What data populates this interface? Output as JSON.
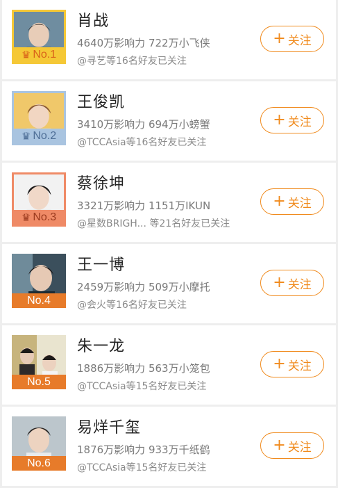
{
  "ranking": [
    {
      "rank": "No.1",
      "name": "肖战",
      "stats": "4640万影响力 722万小飞侠",
      "friends": "@寻艺等16名好友已关注",
      "follow": "关注",
      "badge": "crown"
    },
    {
      "rank": "No.2",
      "name": "王俊凯",
      "stats": "3410万影响力 694万小螃蟹",
      "friends": "@TCCAsia等16名好友已关注",
      "follow": "关注",
      "badge": "crown"
    },
    {
      "rank": "No.3",
      "name": "蔡徐坤",
      "stats": "3321万影响力 1151万IKUN",
      "friends": "@星数BRIGH...  等21名好友已关注",
      "follow": "关注",
      "badge": "crown"
    },
    {
      "rank": "No.4",
      "name": "王一博",
      "stats": "2459万影响力 509万小摩托",
      "friends": "@会火等16名好友已关注",
      "follow": "关注"
    },
    {
      "rank": "No.5",
      "name": "朱一龙",
      "stats": "1886万影响力 563万小笼包",
      "friends": "@TCCAsia等15名好友已关注",
      "follow": "关注"
    },
    {
      "rank": "No.6",
      "name": "易烊千玺",
      "stats": "1876万影响力 933万千纸鹤",
      "friends": "@TCCAsia等15名好友已关注",
      "follow": "关注"
    }
  ],
  "colors": {
    "accent": "#f08a1c",
    "gold": "#f5c836",
    "silver": "#a9c4e0",
    "bronze": "#ef8a66",
    "rank_bg": "#e77b2a"
  },
  "icons": {
    "crown": "crown-icon",
    "plus": "plus-icon"
  }
}
